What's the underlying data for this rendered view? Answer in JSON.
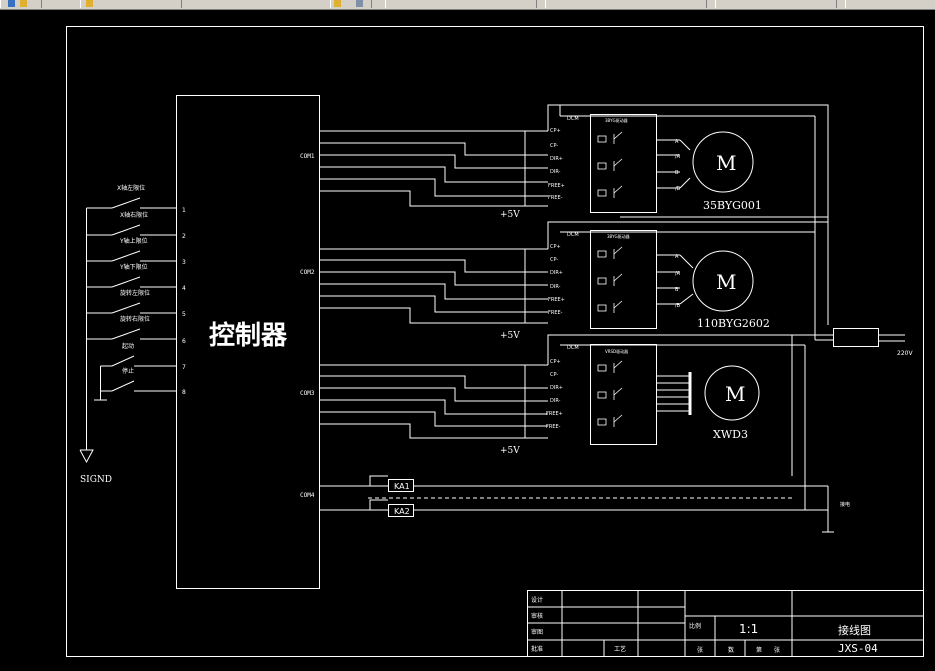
{
  "colors": {
    "background": "#000000",
    "lines": "#ffffff",
    "toolbar": "#d4d0c8"
  },
  "toolbar": {
    "icons": [
      "toolbar-icon"
    ]
  },
  "drawing": {
    "controller_label": "控制器",
    "groups": [
      {
        "port": "COM1",
        "driver": "3BYG驱动器",
        "supply": "+5V",
        "motor_symbol": "M",
        "motor_model": "35BYG001"
      },
      {
        "port": "COM2",
        "driver": "3BYG驱动器",
        "supply": "+5V",
        "motor_symbol": "M",
        "motor_model": "110BYG2602"
      },
      {
        "port": "COM3",
        "driver": "VRSD驱动器",
        "supply": "+5V",
        "motor_symbol": "M",
        "motor_model": "XWD3"
      }
    ],
    "relay_port": "COM4",
    "driver_inputs": [
      "CP+",
      "CP-",
      "DIR+",
      "DIR-",
      "FREE+",
      "FREE-"
    ],
    "driver_outputs": [
      "A",
      "/A",
      "B",
      "/B"
    ],
    "dcm_label": "DCM",
    "switches": [
      "X轴左限位",
      "X轴右限位",
      "Y轴上限位",
      "Y轴下限位",
      "旋转左限位",
      "旋转右限位",
      "起动",
      "停止"
    ],
    "switch_numbers": [
      "1",
      "2",
      "3",
      "4",
      "5",
      "6",
      "7",
      "8"
    ],
    "ground_label": "SIGND",
    "power_label": "220V",
    "relays": [
      "KA1",
      "KA2"
    ],
    "relay_note": "接电",
    "title_block": {
      "rows_left": [
        "设计",
        "审核",
        "审图",
        "批准"
      ],
      "small_label": "工艺",
      "scale_label": "比例",
      "scale": "1:1",
      "sheet_labels": [
        "张",
        "数",
        "第",
        "张"
      ],
      "title": "接线图",
      "number": "JXS-04"
    }
  }
}
